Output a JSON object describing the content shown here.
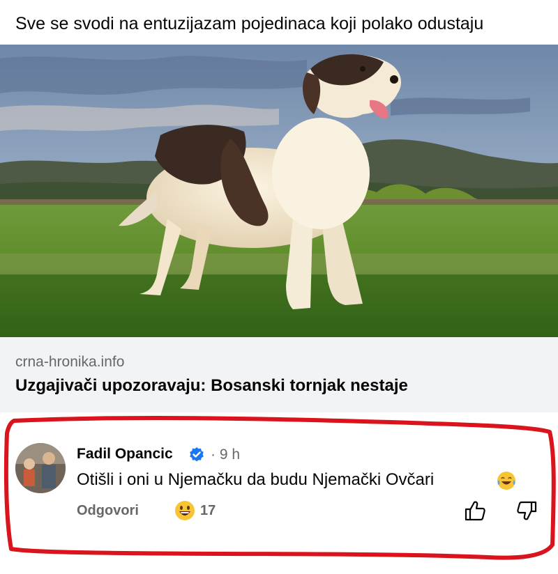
{
  "post": {
    "caption": "Sve se svodi na entuzijazam pojedinaca koji polako odustaju"
  },
  "link_preview": {
    "domain": "crna-hronika.info",
    "title": "Uzgajivači upozoravaju: Bosanski tornjak nestaje"
  },
  "comment": {
    "author": "Fadil Opancic",
    "verified_icon": "verified-badge-icon",
    "time": "· 9 h",
    "text": "Otišli i oni u Njemačku da budu Njemački Ovčari",
    "reply_label": "Odgovori",
    "reaction_count": "17",
    "reaction_icon": "grinning-face-icon",
    "like_icon": "thumbs-up-icon",
    "dislike_icon": "thumbs-down-icon"
  },
  "colors": {
    "highlight": "#d9141c",
    "verified": "#1877f2",
    "muted_text": "#65676b",
    "preview_bg": "#f2f3f5"
  }
}
